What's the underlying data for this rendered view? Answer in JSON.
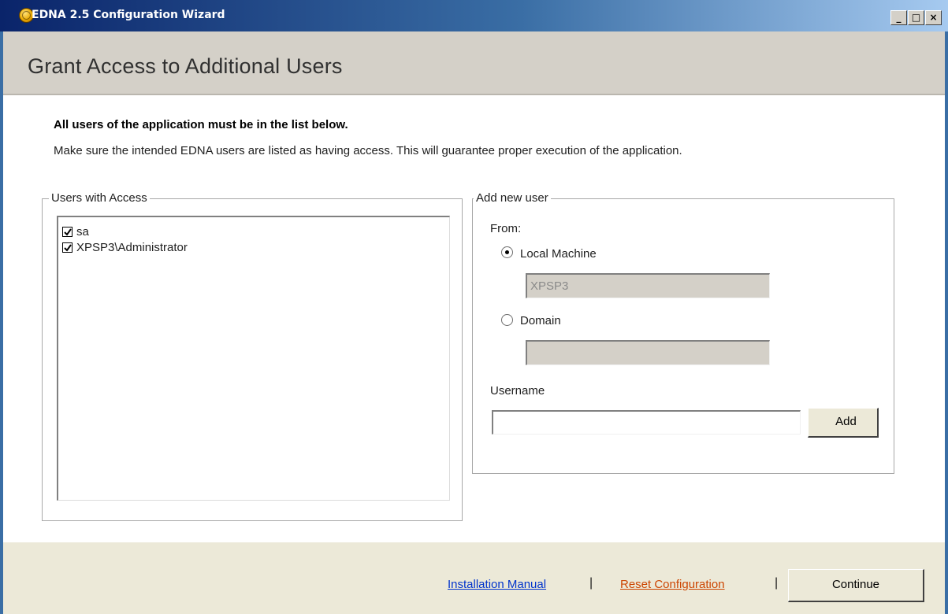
{
  "window": {
    "title": "EDNA 2.5 Configuration Wizard",
    "controls": {
      "minimize": "_",
      "maximize": "□",
      "close": "×"
    }
  },
  "header": {
    "title": "Grant Access to Additional Users"
  },
  "intro": {
    "bold": "All users of the application must be in the list below.",
    "text": "Make sure the intended EDNA users are listed as having access. This will guarantee proper execution of the application."
  },
  "users_group": {
    "legend": "Users with Access",
    "users": [
      {
        "name": "sa",
        "checked": true
      },
      {
        "name": "XPSP3\\Administrator",
        "checked": true
      }
    ]
  },
  "add_group": {
    "legend": "Add new user",
    "from_label": "From:",
    "local_label": "Local Machine",
    "local_value": "XPSP3",
    "domain_label": "Domain",
    "domain_value": "",
    "selected_source": "Local Machine",
    "username_label": "Username",
    "username_value": "",
    "add_label": "Add"
  },
  "footer": {
    "manual_link": "Installation Manual",
    "reset_link": "Reset Configuration",
    "separator": "|",
    "continue_label": "Continue"
  },
  "colors": {
    "title_bar_start": "#0a246a",
    "title_bar_end": "#a6caf0",
    "header_bg": "#d4d0c8",
    "manual_link": "#0033cc",
    "reset_link": "#cc4400"
  }
}
